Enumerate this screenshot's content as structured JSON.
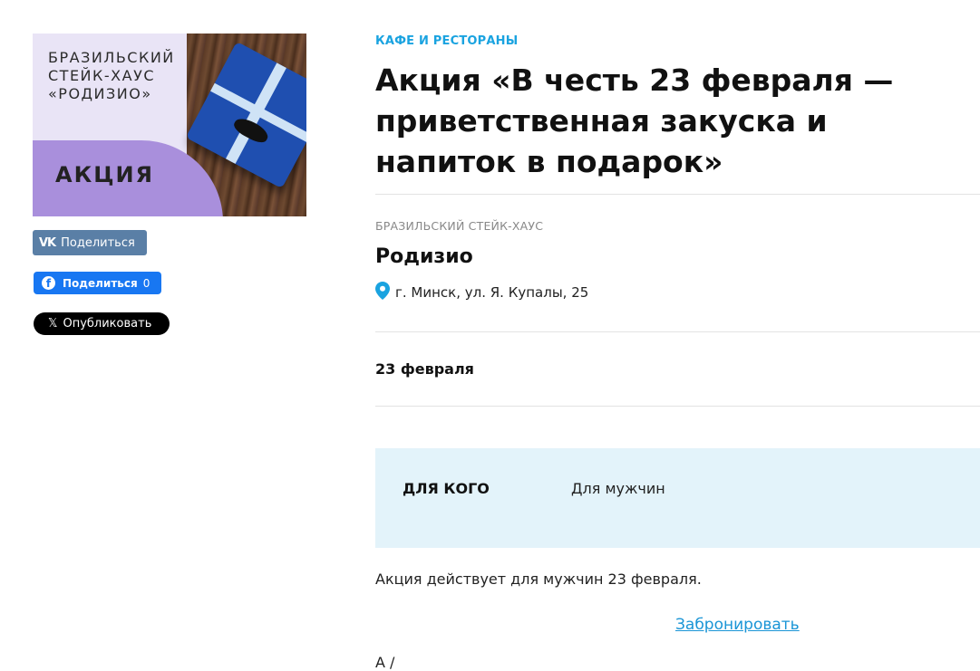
{
  "promo": {
    "title": "БРАЗИЛЬСКИЙ\nСТЕЙК-ХАУС\n«РОДИЗИО»",
    "badge": "АКЦИЯ"
  },
  "share": {
    "vk_logo": "VK",
    "vk_label": "Поделиться",
    "fb_label": "Поделиться",
    "fb_count": "0",
    "x_label": "Опубликовать",
    "colors": {
      "vk": "#5a7fa6",
      "fb": "#1877f2",
      "x": "#000000"
    }
  },
  "article": {
    "category": "КАФЕ И РЕСТОРАНЫ",
    "title": "Акция «В честь 23 февраля — приветственная закуска и напиток в подарок»",
    "venue_type": "БРАЗИЛЬСКИЙ СТЕЙК-ХАУС",
    "venue_name": "Родизио",
    "address": "г. Минск, ул. Я. Купалы, 25",
    "date": "23 февраля",
    "audience_label": "ДЛЯ КОГО",
    "audience_value": "Для мужчин",
    "description": "Акция действует для мужчин 23 февраля.",
    "book_label": "Забронировать",
    "cut_text": "А   /",
    "accent_color": "#1aa3e0"
  },
  "icons": {
    "pin": "map-pin-icon",
    "vk": "vk-icon",
    "fb": "facebook-icon",
    "x": "x-icon"
  }
}
